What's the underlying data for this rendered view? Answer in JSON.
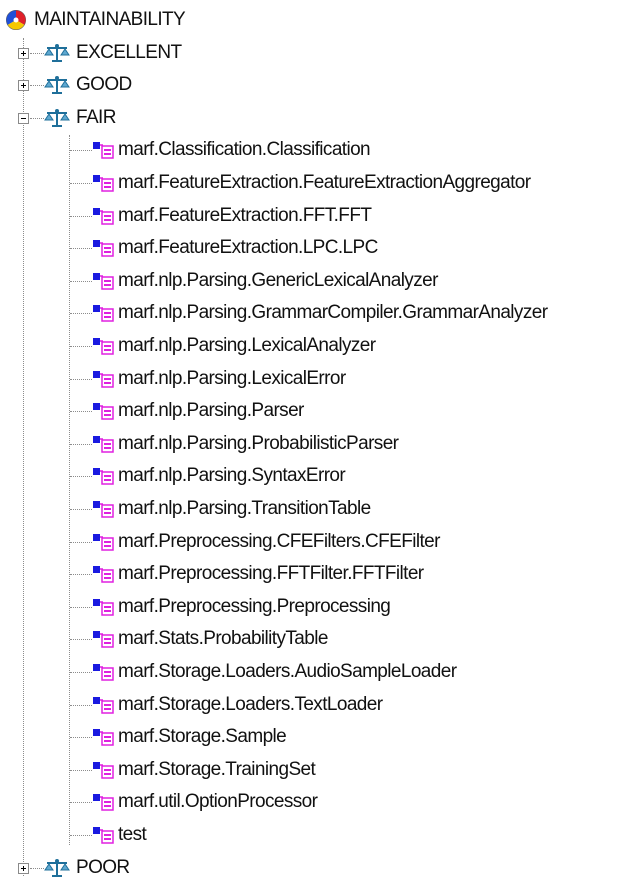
{
  "root": {
    "label": "MAINTAINABILITY",
    "icon": "maintainability-root-icon"
  },
  "categories": [
    {
      "label": "EXCELLENT",
      "expanded": false,
      "icon": "scale-icon"
    },
    {
      "label": "GOOD",
      "expanded": false,
      "icon": "scale-icon"
    },
    {
      "label": "FAIR",
      "expanded": true,
      "icon": "scale-icon"
    },
    {
      "label": "POOR",
      "expanded": false,
      "icon": "scale-icon"
    }
  ],
  "fair_items": [
    "marf.Classification.Classification",
    "marf.FeatureExtraction.FeatureExtractionAggregator",
    "marf.FeatureExtraction.FFT.FFT",
    "marf.FeatureExtraction.LPC.LPC",
    "marf.nlp.Parsing.GenericLexicalAnalyzer",
    "marf.nlp.Parsing.GrammarCompiler.GrammarAnalyzer",
    "marf.nlp.Parsing.LexicalAnalyzer",
    "marf.nlp.Parsing.LexicalError",
    "marf.nlp.Parsing.Parser",
    "marf.nlp.Parsing.ProbabilisticParser",
    "marf.nlp.Parsing.SyntaxError",
    "marf.nlp.Parsing.TransitionTable",
    "marf.Preprocessing.CFEFilters.CFEFilter",
    "marf.Preprocessing.FFTFilter.FFTFilter",
    "marf.Preprocessing.Preprocessing",
    "marf.Stats.ProbabilityTable",
    "marf.Storage.Loaders.AudioSampleLoader",
    "marf.Storage.Loaders.TextLoader",
    "marf.Storage.Sample",
    "marf.Storage.TrainingSet",
    "marf.util.OptionProcessor",
    "test"
  ],
  "colors": {
    "root_red": "#e0202a",
    "root_yellow": "#f5c800",
    "root_blue": "#2050d8",
    "scale_teal": "#1f6f9a",
    "class_blue": "#1a1ae0",
    "class_magenta": "#e020e0"
  }
}
